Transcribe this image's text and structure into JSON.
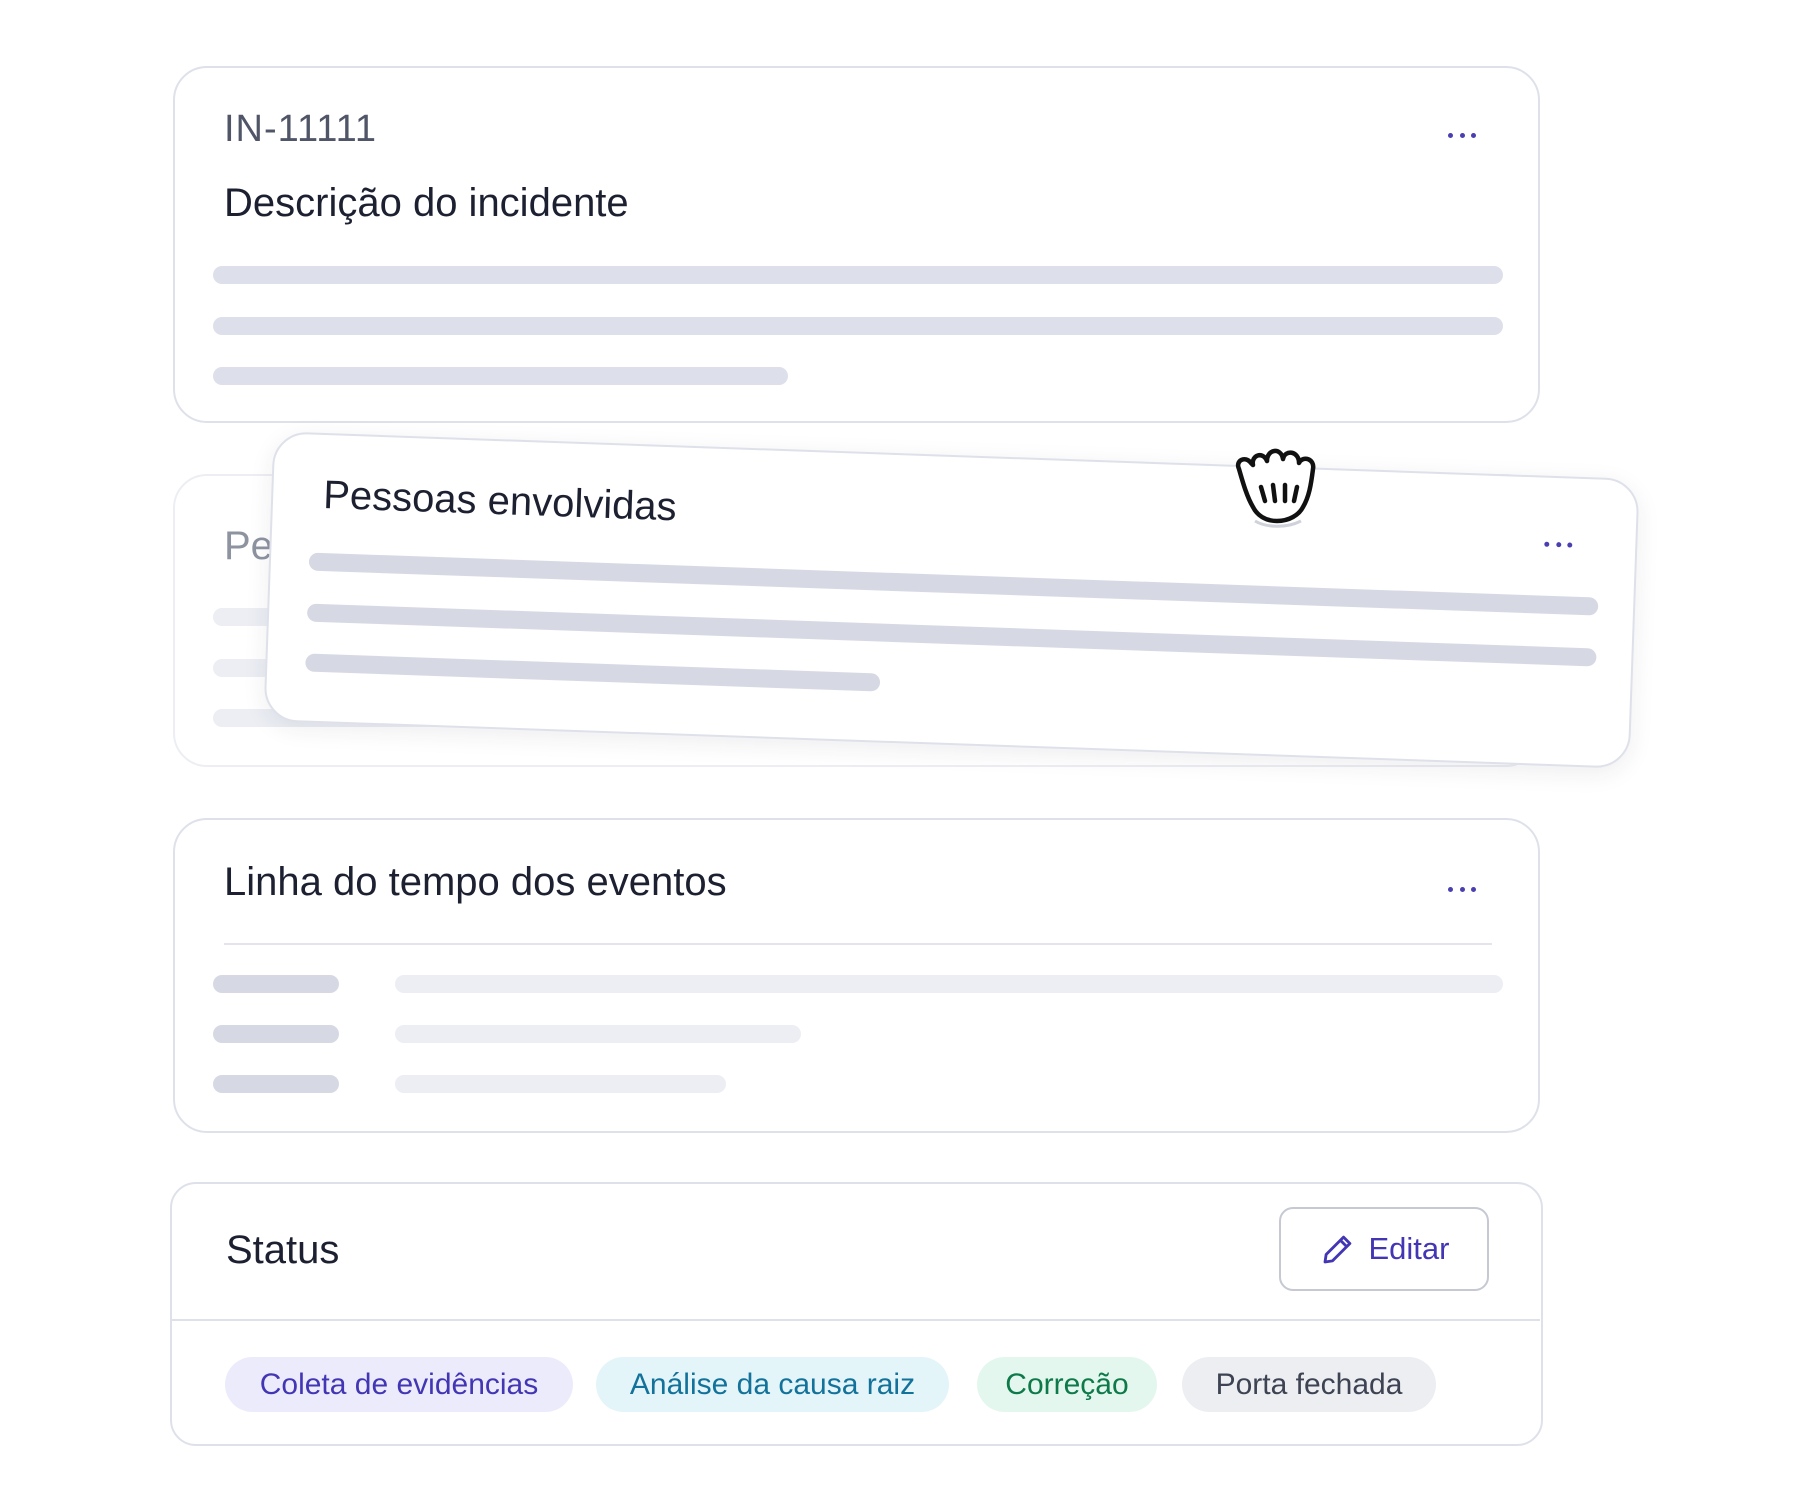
{
  "incident_card": {
    "id": "IN-11111",
    "title": "Descrição do incidente"
  },
  "people_card": {
    "title_ghost": "Pe",
    "title": "Pessoas envolvidas"
  },
  "timeline_card": {
    "title": "Linha do tempo dos eventos"
  },
  "status_card": {
    "title": "Status",
    "edit_label": "Editar",
    "chips": [
      {
        "label": "Coleta de evidências",
        "color": "#4236b4",
        "bg": "#ecebfb"
      },
      {
        "label": "Análise da causa raiz",
        "color": "#13729a",
        "bg": "#e3f5f9"
      },
      {
        "label": "Correção",
        "color": "#0e7a49",
        "bg": "#e4f7ef"
      },
      {
        "label": "Porta fechada",
        "color": "#3d4352",
        "bg": "#eceef2"
      }
    ]
  },
  "icons": {
    "more": "more-horizontal-icon",
    "edit": "pencil-icon",
    "cursor": "grab-hand-cursor-icon"
  },
  "colors": {
    "accent": "#4a3fb0",
    "skeleton": "#dde0ea",
    "border": "#dfe1ea"
  }
}
